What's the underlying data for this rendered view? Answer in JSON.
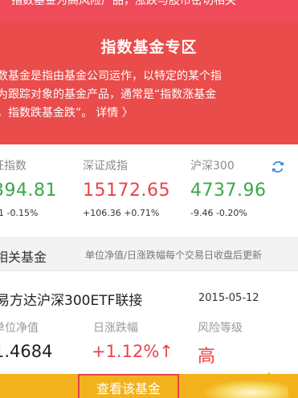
{
  "top_warning": "指数基金为高风险产品，涨跌与股市密切相关",
  "banner": {
    "title": "指数基金专区",
    "line1": "数基金是指由基金公司运作，以特定的某个指",
    "line2": "为跟踪对象的基金产品，通常是“指数涨基金",
    "line3": "，指数跌基金跌”。",
    "detail_link": "详情 〉"
  },
  "indices": [
    {
      "name": "证指数",
      "value": "394.81",
      "change": "41  -0.15%",
      "color": "green"
    },
    {
      "name": "深证成指",
      "value": "15172.65",
      "change": "+106.36  +0.71%",
      "color": "red"
    },
    {
      "name": "沪深300",
      "value": "4737.96",
      "change": "-9.46  -0.20%",
      "color": "green"
    }
  ],
  "section": {
    "title": "相关基金",
    "note": "单位净值/日涨跌幅每个交易日收盘后更新"
  },
  "fund": {
    "name": "易方达沪深300ETF联接",
    "date": "2015-05-12",
    "nav_label": "单位净值",
    "nav_value": "1.4684",
    "change_label": "日涨跌幅",
    "change_value": "+1.12%↑",
    "risk_label": "风险等级",
    "risk_value": "高"
  },
  "cta_label": "查看该基金",
  "colors": {
    "accent_red": "#e94c4a",
    "up": "#e8434b",
    "down": "#3aa74a",
    "bottom_bar": "#f2b21b"
  },
  "icons": {
    "refresh": "refresh-icon",
    "arrow": "arrow-up-icon"
  }
}
